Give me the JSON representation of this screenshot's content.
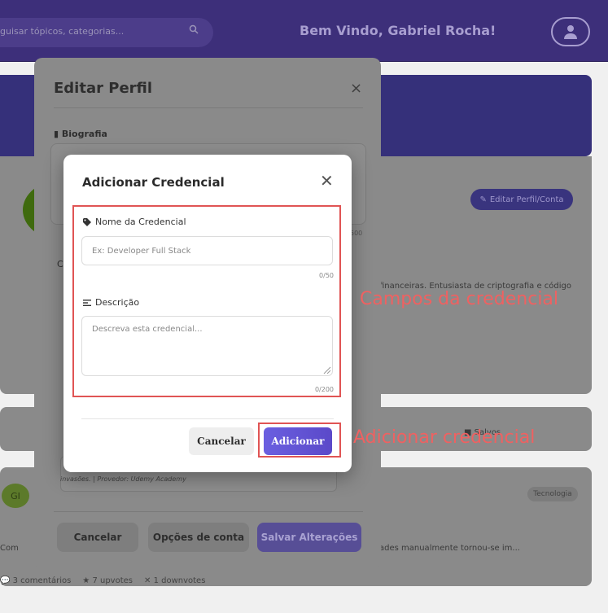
{
  "header": {
    "search_placeholder": "guisar tópicos, categorias...",
    "welcome": "Bem Vindo, Gabriel Rocha!"
  },
  "background": {
    "edit_profile_account_button": "Editar Perfil/Conta",
    "bio_excerpt": "financeiras. Entusiasta de criptografia e código",
    "saved_tab": "Salvos",
    "post_avatar_initials": "GI",
    "post_tag": "Tecnologia",
    "post_text_right": "ades manualmente tornou-se im...",
    "post_text_left": "Com",
    "stats": {
      "comments": "3 comentários",
      "upvotes": "7 upvotes",
      "downvotes": "1 downvotes"
    }
  },
  "edit_modal": {
    "title": "Editar Perfil",
    "biography_label": "Biografia",
    "bio_count": "500",
    "partial_label": "C",
    "credential_row_text": "invasões. | Provedor: Udemy Academy",
    "cancel": "Cancelar",
    "account_options": "Opções de conta",
    "save": "Salvar Alterações"
  },
  "credential_modal": {
    "title": "Adicionar Credencial",
    "name_label": "Nome da Credencial",
    "name_placeholder": "Ex: Developer Full Stack",
    "name_value": "",
    "name_count": "0/50",
    "description_label": "Descrição",
    "description_placeholder": "Descreva esta credencial...",
    "description_value": "",
    "description_count": "0/200",
    "cancel": "Cancelar",
    "add": "Adicionar"
  },
  "annotations": {
    "fields_label": "Campos da credencial",
    "add_label": "Adicionar credencial",
    "color": "#e05454"
  }
}
